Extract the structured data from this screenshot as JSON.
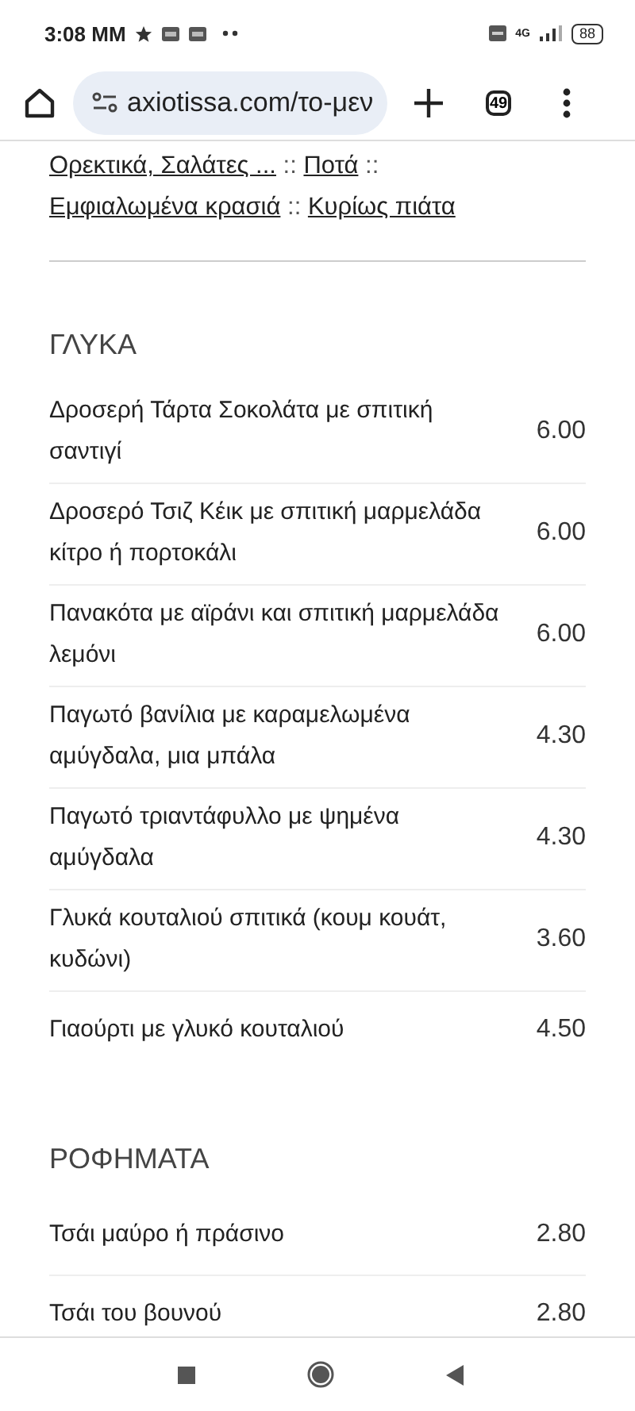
{
  "status_bar": {
    "time": "3:08 ΜΜ",
    "network": "4G",
    "battery": "88"
  },
  "browser": {
    "url": "axiotissa.com/το-μεν",
    "tab_count": "49"
  },
  "category_links": {
    "separator": "::",
    "links": [
      {
        "text": "Ορεκτικά, Σαλάτες ..."
      },
      {
        "text": "Ποτά"
      },
      {
        "text": "Εμφιαλωμένα κρασιά"
      },
      {
        "text": "Κυρίως πιάτα"
      }
    ]
  },
  "sections": [
    {
      "title": "ΓΛΥΚΑ",
      "items": [
        {
          "name": "Δροσερή Τάρτα Σοκολάτα με σπιτική σαντιγί",
          "price": "6.00"
        },
        {
          "name": "Δροσερό Τσιζ Κέικ με σπιτική μαρμελάδα κίτρο ή πορτοκάλι",
          "price": "6.00"
        },
        {
          "name": "Πανακότα με αϊράνι και σπιτική μαρμελάδα λεμόνι",
          "price": "6.00"
        },
        {
          "name": "Παγωτό βανίλια με καραμελωμένα αμύγδαλα, μια μπάλα",
          "price": "4.30"
        },
        {
          "name": "Παγωτό τριαντάφυλλο με ψημένα αμύγδαλα",
          "price": "4.30"
        },
        {
          "name": "Γλυκά κουταλιού σπιτικά (κουμ κουάτ, κυδώνι)",
          "price": "3.60"
        },
        {
          "name": "Γιαούρτι με γλυκό κουταλιού",
          "price": "4.50"
        }
      ]
    },
    {
      "title": "ΡΟΦΗΜΑΤΑ",
      "items": [
        {
          "name": "Τσάι μαύρο ή πράσινο",
          "price": "2.80"
        },
        {
          "name": "Τσάι του βουνού",
          "price": "2.80"
        }
      ]
    }
  ]
}
